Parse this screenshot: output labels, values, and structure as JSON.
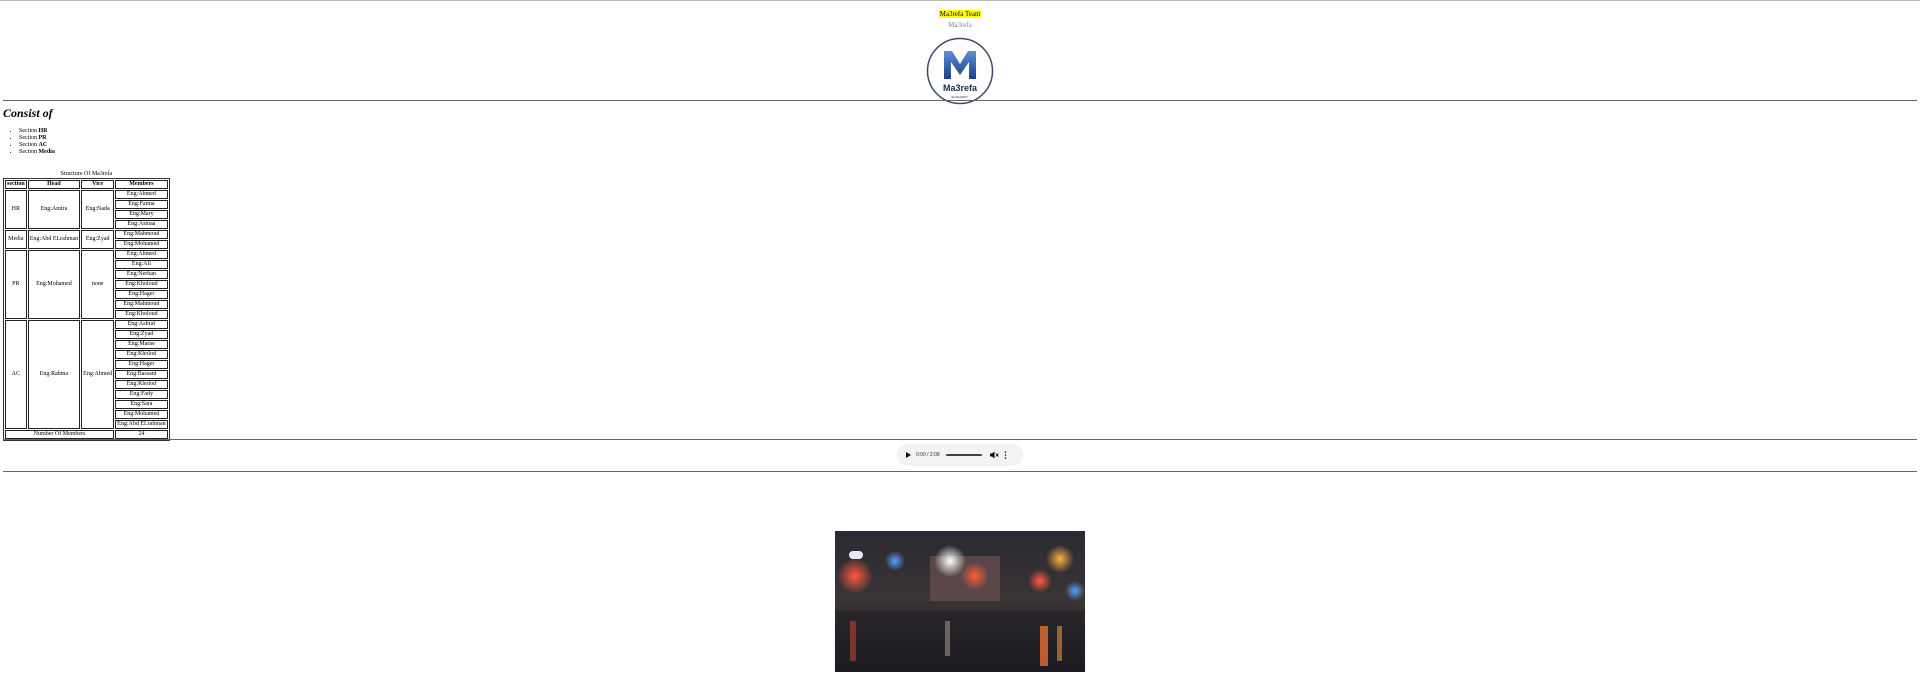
{
  "header": {
    "team_title": "Ma3refa Team",
    "subtitle": "Ma3refa",
    "logo_letter": "M",
    "logo_text": "Ma3refa",
    "logo_tagline": "ELMAARIFY"
  },
  "consist": {
    "heading": "Consist of",
    "items": [
      {
        "prefix": "Section",
        "name": "HR"
      },
      {
        "prefix": "Section",
        "name": "PR"
      },
      {
        "prefix": "Section",
        "name": "AC"
      },
      {
        "prefix": "Section",
        "name": "Media"
      }
    ]
  },
  "structure_table": {
    "caption": "Structure Of Ma3refa",
    "headers": {
      "section": "section",
      "head": "Head",
      "vice": "Vice",
      "members": "Members"
    },
    "groups": [
      {
        "section": "HR",
        "head": "Eng:Amira",
        "vice": "Eng:Nada",
        "members": [
          "Eng:Ahmed",
          "Eng:Fatma",
          "Eng:Mary",
          "Eng:Asmaa"
        ]
      },
      {
        "section": "Media",
        "head": "Eng:Abd ELrahman",
        "vice": "Eng:Zyad",
        "members": [
          "Eng:Mahmoud",
          "Eng:Mohamed"
        ]
      },
      {
        "section": "PR",
        "head": "Eng:Mohamed",
        "vice": "none",
        "members": [
          "Eng:Ahmed",
          "Eng:Ali",
          "Eng:Nerhan",
          "Eng:Kholoud",
          "Eng:Hager",
          "Eng:Mahmoud",
          "Eng:Kholoud"
        ]
      },
      {
        "section": "AC",
        "head": "Eng:Rahma",
        "vice": "Eng:Ahmed",
        "members": [
          "Eng:Ashraf",
          "Eng:Zyad",
          "Eng:Marae",
          "Eng:Kholod",
          "Eng:Hager",
          "Eng:Bassant",
          "Eng:Kholod",
          "Eng:Fady",
          "Eng:Sara",
          "Eng:Mohamed",
          "Eng:Abd ELrahman"
        ]
      }
    ],
    "footer_label": "Number Of Members",
    "footer_value": "24"
  },
  "audio_player": {
    "time": "0:00 / 2:08",
    "icons": [
      "play-icon",
      "mute-icon",
      "more-options-icon"
    ]
  },
  "colors": {
    "highlight": "#ffff00",
    "logo_blue": "#1c3f8a",
    "logo_ring": "#3d4a66"
  }
}
